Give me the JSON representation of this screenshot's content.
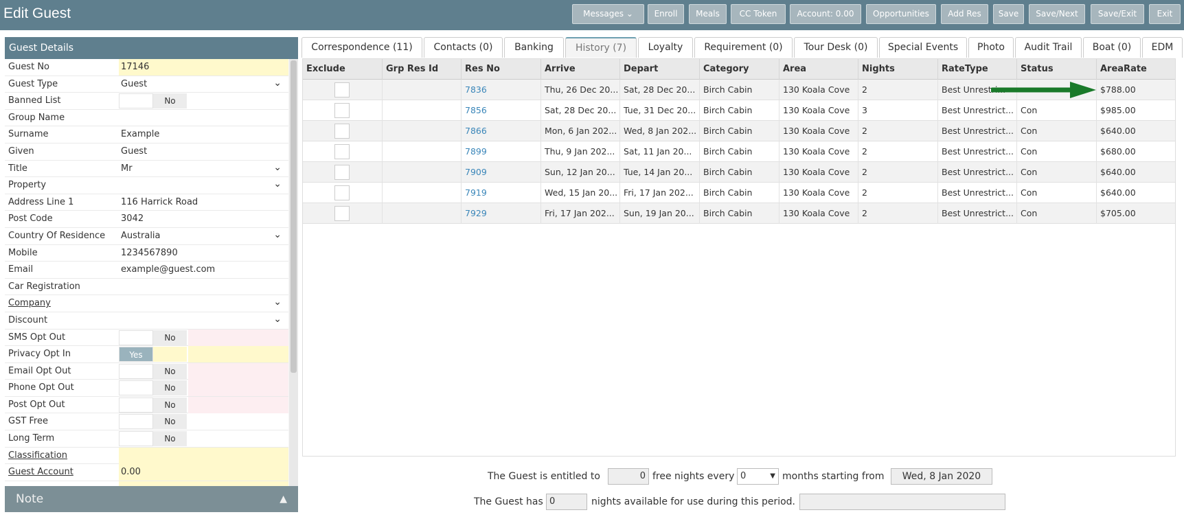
{
  "header": {
    "title": "Edit Guest",
    "buttons": [
      "Messages",
      "Enroll",
      "Meals",
      "CC Token",
      "Account: 0.00",
      "Opportunities",
      "Add Res",
      "Save",
      "Save/Next",
      "Save/Exit",
      "Exit"
    ]
  },
  "guest_details": {
    "heading": "Guest Details",
    "fields": {
      "guest_no": {
        "label": "Guest No",
        "value": "17146"
      },
      "guest_type": {
        "label": "Guest Type",
        "value": "Guest"
      },
      "banned_list": {
        "label": "Banned List",
        "value": "No"
      },
      "group_name": {
        "label": "Group Name",
        "value": ""
      },
      "surname": {
        "label": "Surname",
        "value": "Example"
      },
      "given": {
        "label": "Given",
        "value": "Guest"
      },
      "title": {
        "label": "Title",
        "value": "Mr"
      },
      "property": {
        "label": "Property",
        "value": ""
      },
      "address1": {
        "label": "Address Line 1",
        "value": "116 Harrick Road"
      },
      "post_code": {
        "label": "Post Code",
        "value": "3042"
      },
      "country": {
        "label": "Country Of Residence",
        "value": "Australia"
      },
      "mobile": {
        "label": "Mobile",
        "value": "1234567890"
      },
      "email": {
        "label": "Email",
        "value": "example@guest.com"
      },
      "car_reg": {
        "label": "Car Registration",
        "value": ""
      },
      "company": {
        "label": "Company",
        "value": ""
      },
      "discount": {
        "label": "Discount",
        "value": ""
      },
      "sms_opt_out": {
        "label": "SMS Opt Out",
        "value": "No"
      },
      "privacy_opt_in": {
        "label": "Privacy Opt In",
        "value": "Yes"
      },
      "email_opt_out": {
        "label": "Email Opt Out",
        "value": "No"
      },
      "phone_opt_out": {
        "label": "Phone Opt Out",
        "value": "No"
      },
      "post_opt_out": {
        "label": "Post Opt Out",
        "value": "No"
      },
      "gst_free": {
        "label": "GST Free",
        "value": "No"
      },
      "long_term": {
        "label": "Long Term",
        "value": "No"
      },
      "classification": {
        "label": "Classification",
        "value": ""
      },
      "guest_account": {
        "label": "Guest Account",
        "value": "0.00"
      }
    },
    "note_label": "Note"
  },
  "tabs": [
    "Correspondence (11)",
    "Contacts (0)",
    "Banking",
    "History (7)",
    "Loyalty",
    "Requirement (0)",
    "Tour Desk (0)",
    "Special Events",
    "Photo",
    "Audit Trail",
    "Boat (0)",
    "EDM"
  ],
  "active_tab": "History (7)",
  "history": {
    "columns": [
      "Exclude",
      "Grp Res Id",
      "Res No",
      "Arrive",
      "Depart",
      "Category",
      "Area",
      "Nights",
      "RateType",
      "Status",
      "AreaRate"
    ],
    "rows": [
      {
        "res_no": "7836",
        "arrive": "Thu, 26 Dec 20...",
        "depart": "Sat, 28 Dec 20...",
        "category": "Birch Cabin",
        "area": "130 Koala Cove",
        "nights": "2",
        "rate_type": "Best Unrestri...",
        "status": "",
        "area_rate": "$788.00"
      },
      {
        "res_no": "7856",
        "arrive": "Sat, 28 Dec 20...",
        "depart": "Tue, 31 Dec 20...",
        "category": "Birch Cabin",
        "area": "130 Koala Cove",
        "nights": "3",
        "rate_type": "Best Unrestrict...",
        "status": "Con",
        "area_rate": "$985.00"
      },
      {
        "res_no": "7866",
        "arrive": "Mon, 6 Jan 202...",
        "depart": "Wed, 8 Jan 202...",
        "category": "Birch Cabin",
        "area": "130 Koala Cove",
        "nights": "2",
        "rate_type": "Best Unrestrict...",
        "status": "Con",
        "area_rate": "$640.00"
      },
      {
        "res_no": "7899",
        "arrive": "Thu, 9 Jan 202...",
        "depart": "Sat, 11 Jan 20...",
        "category": "Birch Cabin",
        "area": "130 Koala Cove",
        "nights": "2",
        "rate_type": "Best Unrestrict...",
        "status": "Con",
        "area_rate": "$680.00"
      },
      {
        "res_no": "7909",
        "arrive": "Sun, 12 Jan 20...",
        "depart": "Tue, 14 Jan 20...",
        "category": "Birch Cabin",
        "area": "130 Koala Cove",
        "nights": "2",
        "rate_type": "Best Unrestrict...",
        "status": "Con",
        "area_rate": "$640.00"
      },
      {
        "res_no": "7919",
        "arrive": "Wed, 15 Jan 20...",
        "depart": "Fri, 17 Jan 202...",
        "category": "Birch Cabin",
        "area": "130 Koala Cove",
        "nights": "2",
        "rate_type": "Best Unrestrict...",
        "status": "Con",
        "area_rate": "$640.00"
      },
      {
        "res_no": "7929",
        "arrive": "Fri, 17 Jan 202...",
        "depart": "Sun, 19 Jan 20...",
        "category": "Birch Cabin",
        "area": "130 Koala Cove",
        "nights": "2",
        "rate_type": "Best Unrestrict...",
        "status": "Con",
        "area_rate": "$705.00"
      }
    ]
  },
  "loyalty_footer": {
    "text1": "The Guest is entitled to",
    "free_nights": "0",
    "text2": "free nights every",
    "months": "0",
    "text3": "months starting from",
    "start_date": "Wed, 8 Jan 2020",
    "text4": "The Guest has",
    "available": "0",
    "text5": "nights available for use during this period."
  },
  "colors": {
    "header_bg": "#5f7f8e",
    "arrow": "#1a7a2a",
    "link": "#3a86b9"
  }
}
